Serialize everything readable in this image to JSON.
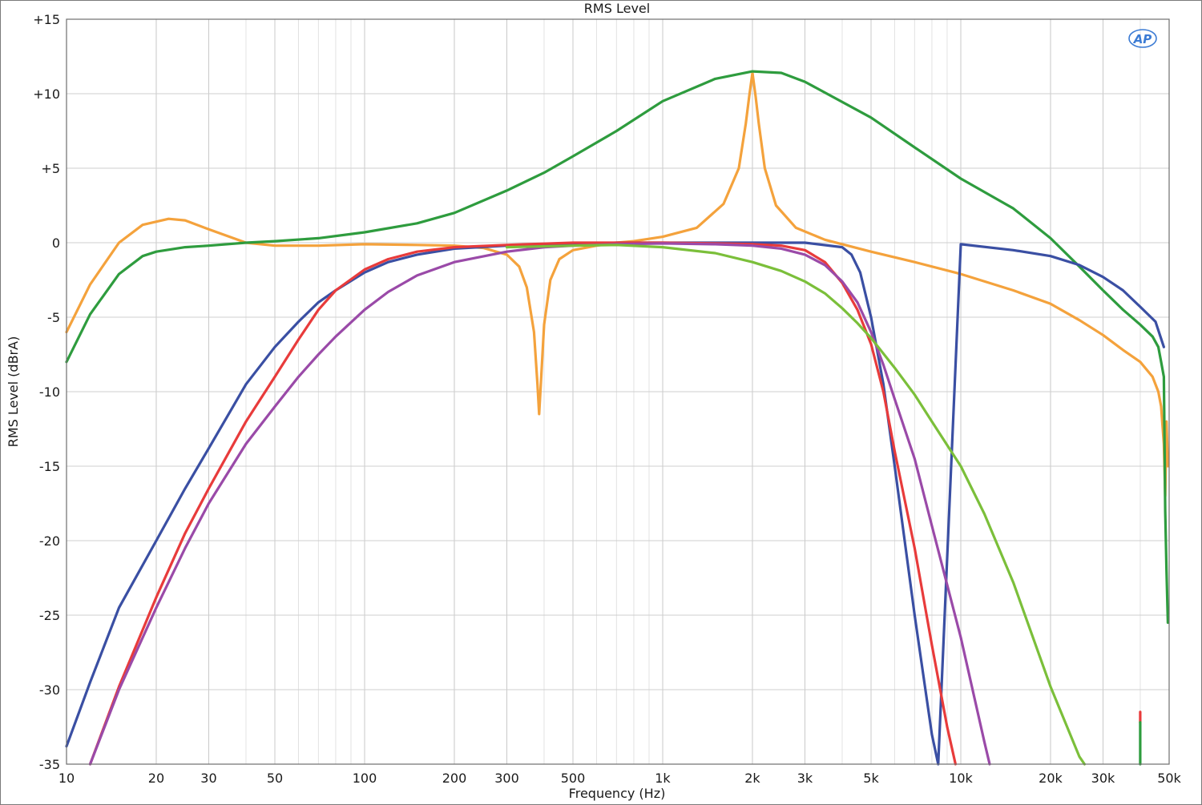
{
  "chart_data": {
    "type": "line",
    "title": "RMS Level",
    "xlabel": "Frequency (Hz)",
    "ylabel": "RMS Level (dBrA)",
    "xscale": "log",
    "xlim": [
      10,
      50000
    ],
    "ylim": [
      -35,
      15
    ],
    "grid": true,
    "logo": "AP",
    "x_ticks": [
      {
        "value": 10,
        "label": "10"
      },
      {
        "value": 20,
        "label": "20"
      },
      {
        "value": 30,
        "label": "30"
      },
      {
        "value": 50,
        "label": "50"
      },
      {
        "value": 100,
        "label": "100"
      },
      {
        "value": 200,
        "label": "200"
      },
      {
        "value": 300,
        "label": "300"
      },
      {
        "value": 500,
        "label": "500"
      },
      {
        "value": 1000,
        "label": "1k"
      },
      {
        "value": 2000,
        "label": "2k"
      },
      {
        "value": 3000,
        "label": "3k"
      },
      {
        "value": 5000,
        "label": "5k"
      },
      {
        "value": 10000,
        "label": "10k"
      },
      {
        "value": 20000,
        "label": "20k"
      },
      {
        "value": 30000,
        "label": "30k"
      },
      {
        "value": 50000,
        "label": "50k"
      }
    ],
    "y_ticks": [
      {
        "value": 15,
        "label": "+15"
      },
      {
        "value": 10,
        "label": "+10"
      },
      {
        "value": 5,
        "label": "+5"
      },
      {
        "value": 0,
        "label": "0"
      },
      {
        "value": -5,
        "label": "-5"
      },
      {
        "value": -10,
        "label": "-10"
      },
      {
        "value": -15,
        "label": "-15"
      },
      {
        "value": -20,
        "label": "-20"
      },
      {
        "value": -25,
        "label": "-25"
      },
      {
        "value": -30,
        "label": "-30"
      },
      {
        "value": -35,
        "label": "-35"
      }
    ],
    "series": [
      {
        "color": "#f4a23c",
        "x": [
          10,
          12,
          15,
          18,
          22,
          25,
          30,
          40,
          50,
          70,
          100,
          150,
          200,
          250,
          300,
          330,
          350,
          370,
          380,
          385,
          390,
          400,
          420,
          450,
          500,
          600,
          700,
          800,
          1000,
          1300,
          1600,
          1800,
          1900,
          1950,
          2000,
          2050,
          2100,
          2200,
          2400,
          2800,
          3500,
          5000,
          7000,
          10000,
          15000,
          20000,
          25000,
          30000,
          35000,
          40000,
          44000,
          46000,
          47000,
          48000,
          48500,
          49000,
          49500
        ],
        "y": [
          -6,
          -2.8,
          0,
          1.2,
          1.6,
          1.5,
          0.9,
          0,
          -0.2,
          -0.2,
          -0.1,
          -0.15,
          -0.2,
          -0.35,
          -0.8,
          -1.6,
          -3,
          -6,
          -9.5,
          -11.5,
          -9.5,
          -5.5,
          -2.5,
          -1.1,
          -0.5,
          -0.2,
          0,
          0.1,
          0.4,
          1,
          2.6,
          5,
          8,
          9.8,
          11.4,
          9.8,
          8,
          5,
          2.5,
          1,
          0.2,
          -0.6,
          -1.3,
          -2.1,
          -3.2,
          -4.1,
          -5.2,
          -6.2,
          -7.2,
          -8,
          -9,
          -10,
          -11,
          -13.5,
          -17,
          -12,
          -15
        ]
      },
      {
        "color": "#2e9c3e",
        "x": [
          10,
          12,
          15,
          18,
          20,
          25,
          30,
          40,
          50,
          70,
          100,
          150,
          200,
          300,
          400,
          500,
          700,
          1000,
          1500,
          2000,
          2500,
          3000,
          5000,
          7000,
          10000,
          15000,
          20000,
          25000,
          30000,
          35000,
          40000,
          44000,
          46000,
          47000,
          48000,
          48500,
          49000,
          49500
        ],
        "y": [
          -8,
          -4.8,
          -2.1,
          -0.9,
          -0.6,
          -0.3,
          -0.2,
          0,
          0.1,
          0.3,
          0.7,
          1.3,
          2,
          3.5,
          4.7,
          5.8,
          7.5,
          9.5,
          11,
          11.5,
          11.4,
          10.8,
          8.4,
          6.4,
          4.3,
          2.3,
          0.3,
          -1.6,
          -3.2,
          -4.5,
          -5.5,
          -6.3,
          -7,
          -8,
          -9,
          -18,
          -22,
          -25.5
        ]
      },
      {
        "color": "#3a4fa3",
        "x": [
          10,
          12,
          15,
          20,
          25,
          30,
          40,
          50,
          60,
          70,
          80,
          100,
          120,
          150,
          200,
          300,
          500,
          700,
          1000,
          1500,
          2000,
          3000,
          4000,
          4300,
          4600,
          5000,
          5500,
          6000,
          7000,
          8000,
          8400,
          10000,
          15000,
          20000,
          25000,
          30000,
          35000,
          40000,
          45000,
          48000
        ],
        "y": [
          -33.8,
          -29.5,
          -24.5,
          -20,
          -16.5,
          -13.8,
          -9.5,
          -7,
          -5.3,
          -4,
          -3.2,
          -2,
          -1.3,
          -0.8,
          -0.4,
          -0.2,
          -0.1,
          0,
          0,
          0,
          0,
          0,
          -0.3,
          -0.8,
          -2,
          -5,
          -9.5,
          -15,
          -25,
          -33,
          -35,
          -0.1,
          -0.5,
          -0.9,
          -1.5,
          -2.3,
          -3.2,
          -4.3,
          -5.3,
          -7
        ]
      },
      {
        "color": "#e83b3b",
        "x": [
          12,
          15,
          20,
          25,
          30,
          40,
          50,
          60,
          70,
          80,
          100,
          120,
          150,
          200,
          300,
          500,
          700,
          1000,
          1500,
          2000,
          2500,
          3000,
          3500,
          4000,
          4500,
          5000,
          5500,
          6000,
          7000,
          8000,
          9000,
          9600
        ],
        "y": [
          -35,
          -29.8,
          -23.8,
          -19.5,
          -16.5,
          -12,
          -9,
          -6.5,
          -4.5,
          -3.2,
          -1.8,
          -1.1,
          -0.6,
          -0.3,
          -0.15,
          0,
          0,
          0,
          -0.05,
          -0.1,
          -0.2,
          -0.5,
          -1.3,
          -2.7,
          -4.5,
          -6.8,
          -10,
          -14,
          -20.5,
          -27,
          -32.5,
          -35
        ]
      },
      {
        "color": "#9a4aa8",
        "x": [
          12,
          15,
          20,
          25,
          30,
          40,
          50,
          60,
          70,
          80,
          100,
          120,
          150,
          200,
          300,
          400,
          500,
          700,
          1000,
          1500,
          2000,
          2500,
          3000,
          3500,
          4000,
          4500,
          5000,
          5500,
          6000,
          7000,
          8000,
          10000,
          12000,
          12500
        ],
        "y": [
          -35,
          -30,
          -24.5,
          -20.5,
          -17.5,
          -13.5,
          -11,
          -9,
          -7.5,
          -6.3,
          -4.5,
          -3.3,
          -2.2,
          -1.3,
          -0.6,
          -0.3,
          -0.2,
          -0.1,
          -0.05,
          -0.1,
          -0.2,
          -0.4,
          -0.8,
          -1.5,
          -2.6,
          -4,
          -6,
          -8.2,
          -10.5,
          -14.5,
          -19,
          -26.5,
          -33.5,
          -35
        ]
      },
      {
        "color": "#7bbf3a",
        "x": [
          300,
          500,
          700,
          1000,
          1500,
          2000,
          2500,
          3000,
          3500,
          4000,
          4500,
          5000,
          6000,
          7000,
          8000,
          10000,
          12000,
          15000,
          20000,
          25000,
          26000
        ],
        "y": [
          -0.3,
          -0.2,
          -0.15,
          -0.3,
          -0.7,
          -1.3,
          -1.9,
          -2.6,
          -3.4,
          -4.4,
          -5.4,
          -6.4,
          -8.4,
          -10.2,
          -12,
          -15,
          -18.2,
          -22.8,
          -29.8,
          -34.5,
          -35
        ]
      },
      {
        "color": "#e83b3b",
        "x": [
          40000,
          40000
        ],
        "y": [
          -31.5,
          -32.2
        ]
      },
      {
        "color": "#2e9c3e",
        "x": [
          40000,
          40000
        ],
        "y": [
          -32.2,
          -35
        ]
      }
    ]
  }
}
